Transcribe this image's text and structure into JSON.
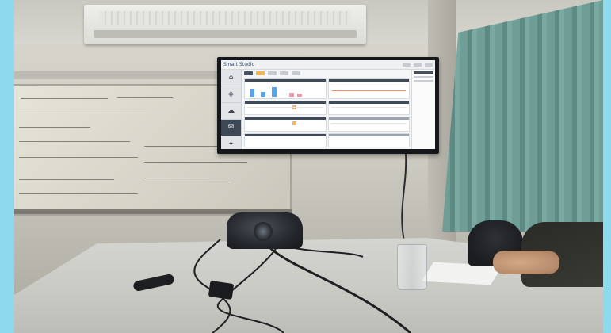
{
  "screen_app": {
    "title": "Smart Studio",
    "nav_icons": [
      "home-icon",
      "layers-icon",
      "cloud-icon",
      "chat-icon",
      "settings-icon"
    ],
    "active_nav_index": 3
  },
  "colors": {
    "accent_blue": "#5aa3e8",
    "accent_pink": "#f19aa5",
    "accent_orange": "#f6b36a",
    "nav_active": "#3d4857"
  }
}
